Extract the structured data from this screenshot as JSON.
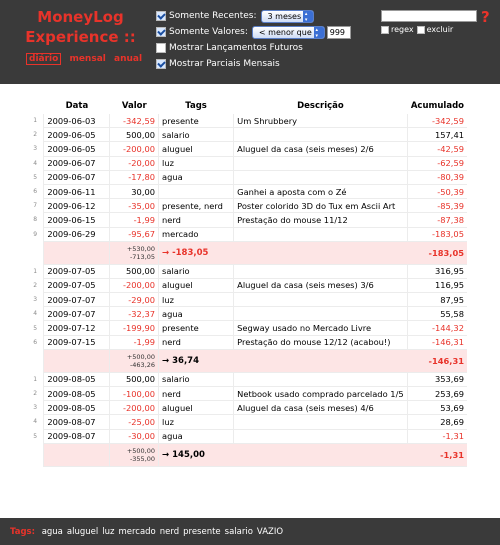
{
  "app": {
    "title_line1": "MoneyLog",
    "title_line2": "Experience ::",
    "help": "?"
  },
  "modes": [
    {
      "label": "diário",
      "active": true
    },
    {
      "label": "mensal",
      "active": false
    },
    {
      "label": "anual",
      "active": false
    }
  ],
  "options": {
    "recent_label": "Somente Recentes:",
    "recent_value": "3 meses",
    "values_label": "Somente Valores:",
    "values_value": "< menor que",
    "values_number": "999",
    "future_label": "Mostrar Lançamentos Futuros",
    "partial_label": "Mostrar Parciais Mensais"
  },
  "search": {
    "value": "",
    "regex_label": "regex",
    "exclude_label": "excluir"
  },
  "table": {
    "headers": {
      "date": "Data",
      "value": "Valor",
      "tags": "Tags",
      "desc": "Descrição",
      "acc": "Acumulado"
    },
    "months": [
      {
        "rows": [
          {
            "n": "1",
            "date": "2009-06-03",
            "value": "-342,59",
            "tags": "presente",
            "desc": "Um Shrubbery",
            "acc": "-342,59"
          },
          {
            "n": "2",
            "date": "2009-06-05",
            "value": "500,00",
            "tags": "salario",
            "desc": "",
            "acc": "157,41"
          },
          {
            "n": "3",
            "date": "2009-06-05",
            "value": "-200,00",
            "tags": "aluguel",
            "desc": "Aluguel da casa (seis meses) 2/6",
            "acc": "-42,59"
          },
          {
            "n": "4",
            "date": "2009-06-07",
            "value": "-20,00",
            "tags": "luz",
            "desc": "",
            "acc": "-62,59"
          },
          {
            "n": "5",
            "date": "2009-06-07",
            "value": "-17,80",
            "tags": "agua",
            "desc": "",
            "acc": "-80,39"
          },
          {
            "n": "6",
            "date": "2009-06-11",
            "value": "30,00",
            "tags": "",
            "desc": "Ganhei a aposta com o Zé",
            "acc": "-50,39"
          },
          {
            "n": "7",
            "date": "2009-06-12",
            "value": "-35,00",
            "tags": "presente, nerd",
            "desc": "Poster colorido 3D do Tux em Ascii Art",
            "acc": "-85,39"
          },
          {
            "n": "8",
            "date": "2009-06-15",
            "value": "-1,99",
            "tags": "nerd",
            "desc": "Prestação do mouse 11/12",
            "acc": "-87,38"
          },
          {
            "n": "9",
            "date": "2009-06-29",
            "value": "-95,67",
            "tags": "mercado",
            "desc": "",
            "acc": "-183,05"
          }
        ],
        "summary": {
          "plus": "+530,00",
          "minus": "-713,05",
          "total": "→  -183,05",
          "acc": "-183,05"
        }
      },
      {
        "rows": [
          {
            "n": "1",
            "date": "2009-07-05",
            "value": "500,00",
            "tags": "salario",
            "desc": "",
            "acc": "316,95"
          },
          {
            "n": "2",
            "date": "2009-07-05",
            "value": "-200,00",
            "tags": "aluguel",
            "desc": "Aluguel da casa (seis meses) 3/6",
            "acc": "116,95"
          },
          {
            "n": "3",
            "date": "2009-07-07",
            "value": "-29,00",
            "tags": "luz",
            "desc": "",
            "acc": "87,95"
          },
          {
            "n": "4",
            "date": "2009-07-07",
            "value": "-32,37",
            "tags": "agua",
            "desc": "",
            "acc": "55,58"
          },
          {
            "n": "5",
            "date": "2009-07-12",
            "value": "-199,90",
            "tags": "presente",
            "desc": "Segway usado no Mercado Livre",
            "acc": "-144,32"
          },
          {
            "n": "6",
            "date": "2009-07-15",
            "value": "-1,99",
            "tags": "nerd",
            "desc": "Prestação do mouse 12/12 (acabou!)",
            "acc": "-146,31"
          }
        ],
        "summary": {
          "plus": "+500,00",
          "minus": "-463,26",
          "total": "→  36,74",
          "acc": "-146,31"
        }
      },
      {
        "rows": [
          {
            "n": "1",
            "date": "2009-08-05",
            "value": "500,00",
            "tags": "salario",
            "desc": "",
            "acc": "353,69"
          },
          {
            "n": "2",
            "date": "2009-08-05",
            "value": "-100,00",
            "tags": "nerd",
            "desc": "Netbook usado comprado parcelado 1/5",
            "acc": "253,69"
          },
          {
            "n": "3",
            "date": "2009-08-05",
            "value": "-200,00",
            "tags": "aluguel",
            "desc": "Aluguel da casa (seis meses) 4/6",
            "acc": "53,69"
          },
          {
            "n": "4",
            "date": "2009-08-07",
            "value": "-25,00",
            "tags": "luz",
            "desc": "",
            "acc": "28,69"
          },
          {
            "n": "5",
            "date": "2009-08-07",
            "value": "-30,00",
            "tags": "agua",
            "desc": "",
            "acc": "-1,31"
          }
        ],
        "summary": {
          "plus": "+500,00",
          "minus": "-355,00",
          "total": "→  145,00",
          "acc": "-1,31"
        }
      }
    ]
  },
  "footer": {
    "label": "Tags:",
    "tags": [
      "agua",
      "aluguel",
      "luz",
      "mercado",
      "nerd",
      "presente",
      "salario",
      "VAZIO"
    ]
  },
  "colors": {
    "accent": "#e8332a",
    "bg_dark": "#3a3a3a",
    "summary_bg": "#fde5e5"
  }
}
